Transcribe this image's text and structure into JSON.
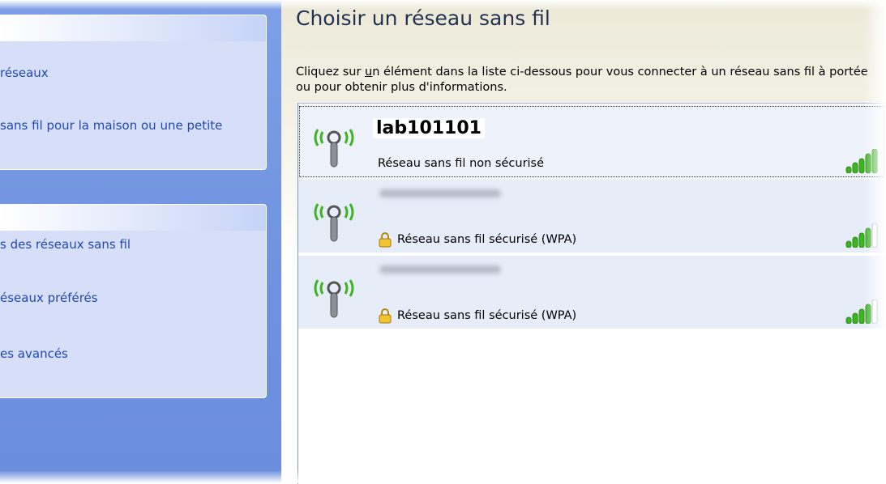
{
  "sidebar": {
    "tasks": [
      {
        "label": "réseaux"
      },
      {
        "label": "sans fil pour la maison ou une petite"
      }
    ],
    "related": [
      {
        "label": "s des réseaux sans fil"
      },
      {
        "label": "éseaux préférés"
      },
      {
        "label": "es avancés"
      }
    ]
  },
  "main": {
    "title": "Choisir un réseau sans fil",
    "instructions_pre": "Cliquez sur ",
    "instructions_underlined": "u",
    "instructions_post": "n élément dans la liste ci-dessous pour vous connecter à un réseau sans fil à portée ou pour obtenir plus d'informations."
  },
  "networks": [
    {
      "ssid": "lab101101",
      "status": "Réseau sans fil non sécurisé",
      "secured": false,
      "selected": true,
      "signal_bars": 5,
      "icon": "wireless-network-icon"
    },
    {
      "ssid": "",
      "status": "Réseau sans fil sécurisé (WPA)",
      "secured": true,
      "selected": false,
      "signal_bars": 4,
      "icon": "wireless-network-icon"
    },
    {
      "ssid": "",
      "status": "Réseau sans fil sécurisé (WPA)",
      "secured": true,
      "selected": false,
      "signal_bars": 4,
      "icon": "wireless-network-icon"
    }
  ],
  "colors": {
    "link": "#2148b8",
    "signal_on": "#3cb521",
    "signal_off": "#ffffff",
    "pane_blue": "#7d9fe6"
  }
}
